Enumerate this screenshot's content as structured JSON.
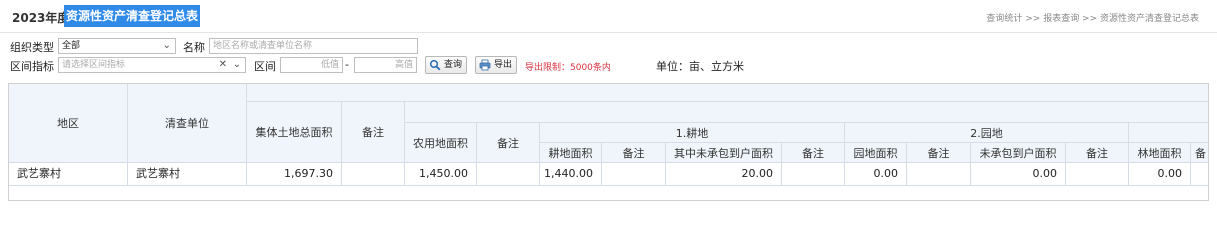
{
  "header": {
    "year_label": "2023年度",
    "title": "资源性资产清查登记总表",
    "breadcrumb": "查询统计 >> 报表查询 >> 资源性资产清查登记总表"
  },
  "filters": {
    "org_type_label": "组织类型",
    "org_type_value": "全部",
    "name_label": "名称",
    "name_placeholder": "地区名称或清查单位名称",
    "range_indicator_label": "区间指标",
    "range_indicator_placeholder": "请选择区间指标",
    "range_label": "区间",
    "low_placeholder": "低值",
    "range_separator": "-",
    "high_placeholder": "高值",
    "query_button": "查询",
    "export_button": "导出",
    "export_limit": "导出限制：5000条内",
    "unit": "单位：亩、立方米"
  },
  "table": {
    "headers": {
      "region": "地区",
      "unit": "清查单位",
      "collective_total": "集体土地总面积",
      "remark1": "备注",
      "farmland": "农用地面积",
      "remark2": "备注",
      "group_cultivated": "1.耕地",
      "cultivated_area": "耕地面积",
      "remark3": "备注",
      "cultivated_not_contracted": "其中未承包到户面积",
      "remark4": "备注",
      "group_garden": "2.园地",
      "garden_area": "园地面积",
      "remark5": "备注",
      "garden_not_contracted": "未承包到户面积",
      "remark6": "备注",
      "forest_area": "林地面积",
      "remark7": "备"
    },
    "rows": [
      {
        "region": "武艺寨村",
        "unit": "武艺寨村",
        "collective_total": "1,697.30",
        "remark1": "",
        "farmland": "1,450.00",
        "remark2": "",
        "cultivated_area": "1,440.00",
        "remark3": "",
        "cultivated_not_contracted": "20.00",
        "remark4": "",
        "garden_area": "0.00",
        "remark5": "",
        "garden_not_contracted": "0.00",
        "remark6": "",
        "forest_area": "0.00",
        "remark7": ""
      }
    ]
  },
  "colors": {
    "title_highlight": "#2f8ae8",
    "header_bg": "#eff5fb",
    "limit_text": "#d9333f"
  }
}
